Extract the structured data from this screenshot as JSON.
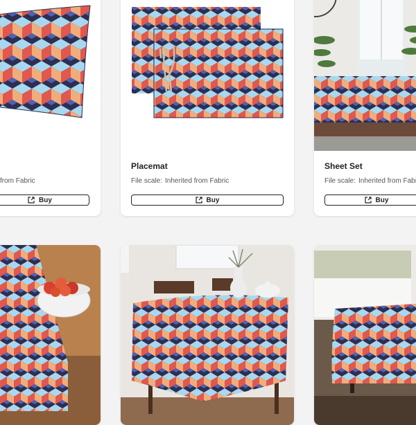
{
  "products": [
    {
      "title": "",
      "scale_label": "",
      "scale_value": "from Fabric",
      "buy_label": "Buy"
    },
    {
      "title": "Placemat",
      "scale_label": "File scale:",
      "scale_value": "Inherited from Fabric",
      "buy_label": "Buy"
    },
    {
      "title": "Sheet Set",
      "scale_label": "File scale:",
      "scale_value": "Inherited from Fabric",
      "buy_label": "Buy"
    }
  ],
  "pattern_colors": {
    "navy": "#2c2f52",
    "blue": "#4d62b6",
    "light_blue": "#a8d8ef",
    "peach": "#f0ad7c",
    "red": "#e0584e"
  }
}
